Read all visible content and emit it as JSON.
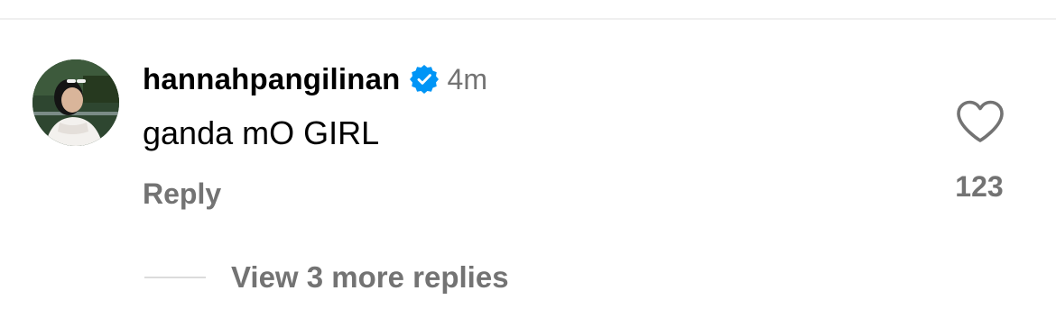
{
  "comment": {
    "username": "hannahpangilinan",
    "verified": true,
    "verified_icon": "verified-badge-icon",
    "timestamp": "4m",
    "text": "ganda mO GIRL",
    "reply_label": "Reply",
    "like_icon": "heart-outline-icon",
    "like_count": "123",
    "view_replies_label": "View 3 more replies"
  },
  "colors": {
    "primary_text": "#000000",
    "secondary_text": "#737373",
    "verified_blue": "#0095f6",
    "divider": "#dbdbdb",
    "background": "#ffffff"
  }
}
